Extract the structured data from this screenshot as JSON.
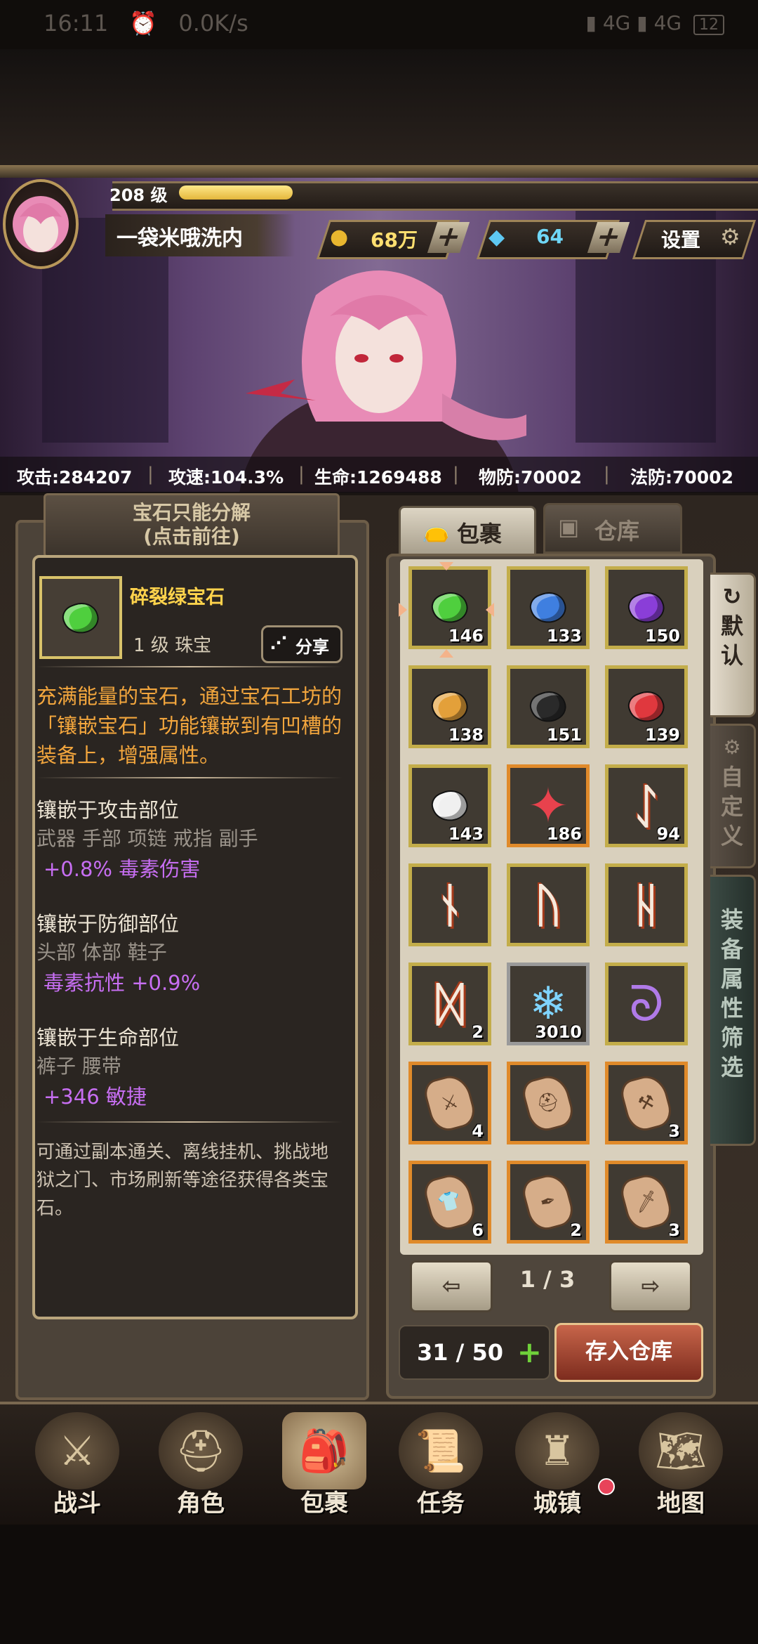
{
  "status_bar": {
    "time": "16:11",
    "speed": "0.0K/s",
    "network1": "4G",
    "network2": "4G",
    "battery": "12"
  },
  "player": {
    "level_label": "208 级",
    "name": "一袋米哦洗内",
    "level_progress": 0.18
  },
  "currency": {
    "gold": "68万",
    "diamond": "64",
    "settings_label": "设置"
  },
  "stats": [
    {
      "label": "攻击:284207"
    },
    {
      "label": "攻速:104.3%"
    },
    {
      "label": "生命:1269488"
    },
    {
      "label": "物防:70002"
    },
    {
      "label": "法防:70002"
    }
  ],
  "left_tab": {
    "line1": "宝石只能分解",
    "line2": "(点击前往)"
  },
  "item": {
    "name": "碎裂绿宝石",
    "level": "1 级 珠宝",
    "share_label": "分享",
    "description": "充满能量的宝石，通过宝石工坊的「镶嵌宝石」功能镶嵌到有凹槽的装备上，增强属性。",
    "sections": [
      {
        "title": "镶嵌于攻击部位",
        "parts": "武器 手部 项链 戒指 副手",
        "bonus": "+0.8% 毒素伤害"
      },
      {
        "title": "镶嵌于防御部位",
        "parts": "头部 体部 鞋子",
        "bonus": "毒素抗性 +0.9%"
      },
      {
        "title": "镶嵌于生命部位",
        "parts": "裤子 腰带",
        "bonus": "+346 敏捷"
      }
    ],
    "sources": "可通过副本通关、离线挂机、挑战地狱之门、市场刷新等途径获得各类宝石。"
  },
  "tabs": {
    "bag": "包裹",
    "warehouse": "仓库"
  },
  "side_tabs": {
    "default": "默认",
    "custom": "自定义",
    "filter": "装备属性筛选"
  },
  "slots": [
    {
      "count": "146",
      "kind": "gem",
      "color": "#4fcf3e"
    },
    {
      "count": "133",
      "kind": "gem",
      "color": "#3f7fe0"
    },
    {
      "count": "150",
      "kind": "gem",
      "color": "#8a3ed8"
    },
    {
      "count": "138",
      "kind": "gem",
      "color": "#e3a03a"
    },
    {
      "count": "151",
      "kind": "gem",
      "color": "#2a2a2a"
    },
    {
      "count": "139",
      "kind": "gem",
      "color": "#e0383e"
    },
    {
      "count": "143",
      "kind": "gem",
      "color": "#f0f0f0"
    },
    {
      "count": "186",
      "kind": "crystal",
      "color": "#e8424d"
    },
    {
      "count": "94",
      "kind": "rune",
      "glyph": "ᛇ"
    },
    {
      "count": "",
      "kind": "rune",
      "glyph": "ᚾ"
    },
    {
      "count": "",
      "kind": "rune",
      "glyph": "ᚢ"
    },
    {
      "count": "",
      "kind": "rune",
      "glyph": "ᚺ"
    },
    {
      "count": "2",
      "kind": "rune",
      "glyph": "ᛞ"
    },
    {
      "count": "3010",
      "kind": "shard",
      "color": "#7fd4ff"
    },
    {
      "count": "",
      "kind": "swirl",
      "color": "#b07ae8"
    },
    {
      "count": "4",
      "kind": "stone",
      "glyph": "⚔"
    },
    {
      "count": "",
      "kind": "stone",
      "glyph": "⛑"
    },
    {
      "count": "3",
      "kind": "stone",
      "glyph": "⚒"
    },
    {
      "count": "6",
      "kind": "stone",
      "glyph": "👕"
    },
    {
      "count": "2",
      "kind": "stone",
      "glyph": "✒"
    },
    {
      "count": "3",
      "kind": "stone",
      "glyph": "🗡"
    }
  ],
  "pager": {
    "page": "1 / 3"
  },
  "capacity": "31 / 50",
  "store_button": "存入仓库",
  "nav": [
    {
      "label": "战斗",
      "icon": "crossed-swords-icon"
    },
    {
      "label": "角色",
      "icon": "helmet-icon"
    },
    {
      "label": "包裹",
      "icon": "backpack-icon"
    },
    {
      "label": "任务",
      "icon": "scroll-icon"
    },
    {
      "label": "城镇",
      "icon": "tower-icon"
    },
    {
      "label": "地图",
      "icon": "map-icon"
    }
  ]
}
